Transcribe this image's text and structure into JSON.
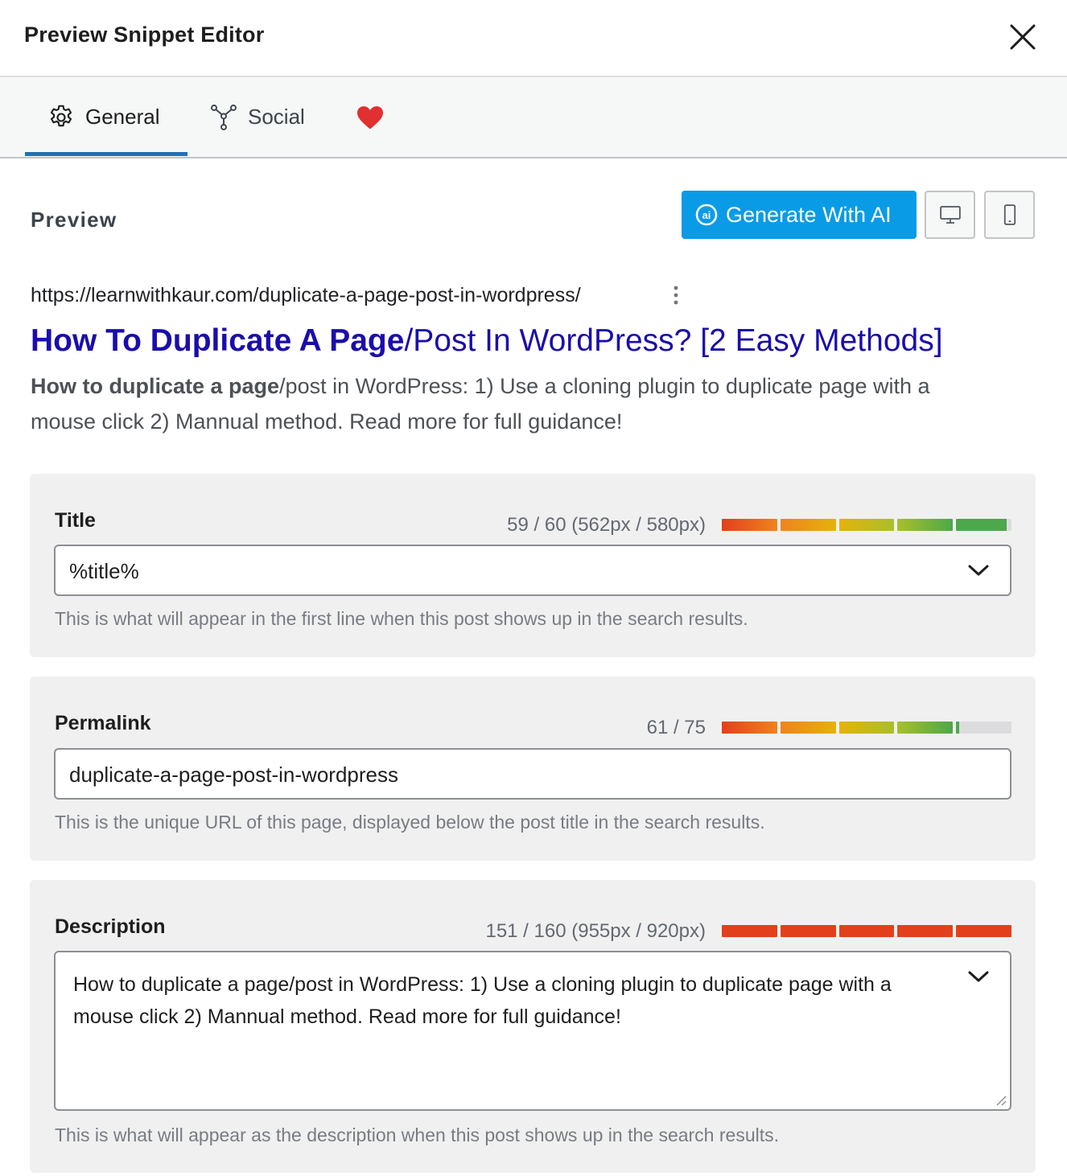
{
  "modal": {
    "title": "Preview Snippet Editor"
  },
  "tabs": [
    {
      "label": "General",
      "icon": "gear-icon",
      "active": true
    },
    {
      "label": "Social",
      "icon": "share-nodes-icon",
      "active": false
    },
    {
      "label": "",
      "icon": "heart-icon",
      "active": false
    }
  ],
  "preview": {
    "label": "Preview",
    "ai_button": "Generate With AI"
  },
  "serp": {
    "url": "https://learnwithkaur.com/duplicate-a-page-post-in-wordpress/",
    "title_bold": "How To Duplicate A Page",
    "title_rest": "/Post In WordPress? [2 Easy Methods]",
    "desc_bold": "How to duplicate a page",
    "desc_rest": "/post in WordPress: 1) Use a cloning plugin to duplicate page with a mouse click 2) Mannual method. Read more for full guidance!"
  },
  "fields": {
    "title": {
      "label": "Title",
      "counter": "59 / 60 (562px / 580px)",
      "value": "%title%",
      "help": "This is what will appear in the first line when this post shows up in the search results.",
      "meter_fill": 0.983
    },
    "permalink": {
      "label": "Permalink",
      "counter": "61 / 75",
      "value": "duplicate-a-page-post-in-wordpress",
      "help": "This is the unique URL of this page, displayed below the post title in the search results.",
      "meter_fill": 0.813
    },
    "description": {
      "label": "Description",
      "counter": "151 / 160 (955px / 920px)",
      "value": "How to duplicate a page/post in WordPress: 1) Use a cloning plugin to duplicate page with a mouse click 2) Mannual method. Read more for full guidance!",
      "help": "This is what will appear as the description when this post shows up in the search results.",
      "meter_fill": 1.0,
      "meter_over_limit": true
    }
  },
  "colors": {
    "accent_blue": "#2271b1",
    "ai_button": "#0a9be7",
    "serp_link": "#1a0dab",
    "meter_gradient": [
      "#e2401c",
      "#f0831e",
      "#e5b20b",
      "#a9bf2a",
      "#4ca84a"
    ],
    "meter_over": "#e2401c",
    "meter_empty": "#dcdcde"
  }
}
